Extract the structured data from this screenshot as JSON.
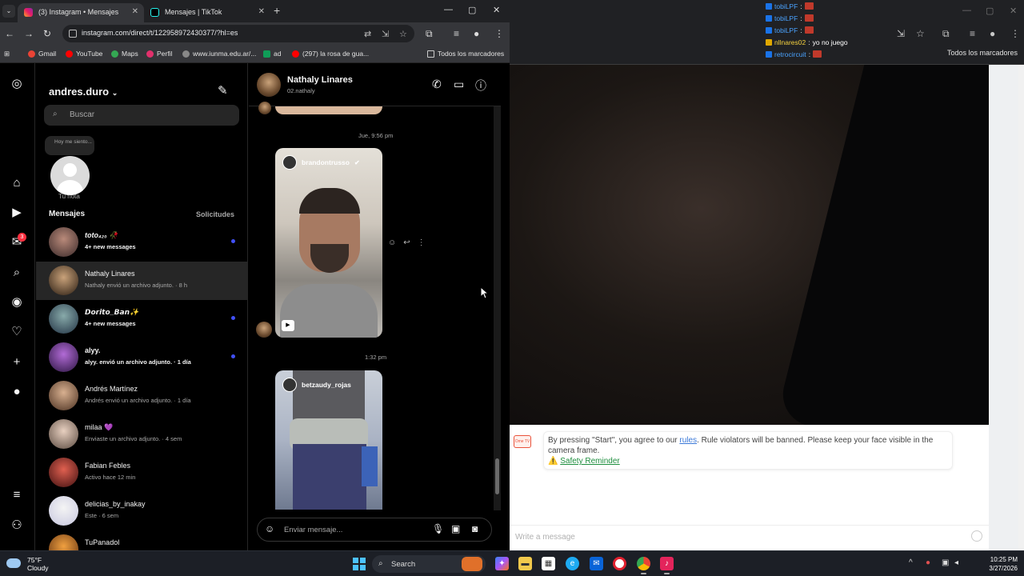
{
  "browser": {
    "tabs": [
      {
        "label": "(3) Instagram • Mensajes",
        "active": true
      },
      {
        "label": "Mensajes | TikTok",
        "active": false
      }
    ],
    "url": "instagram.com/direct/t/122958972430377/?hl=es",
    "bookmarks": [
      "Gmail",
      "YouTube",
      "Maps",
      "Perfil",
      "www.iunma.edu.ar/...",
      "ad",
      "(297) la rosa de gua...",
      "Todos los marcadores"
    ]
  },
  "instagram": {
    "account": "andres.duro",
    "search_placeholder": "Buscar",
    "note_bubble": "Hoy me siento...",
    "note_label": "Tu nota",
    "messages_title": "Mensajes",
    "requests_label": "Solicitudes",
    "notification_count": "3",
    "conversations": [
      {
        "name": "toto₄₂₀ 🥀",
        "sub": "4+ new messages",
        "unread": true
      },
      {
        "name": "Nathaly Linares",
        "sub": "Nathaly envió un archivo adjunto. · 8 h",
        "unread": false
      },
      {
        "name": "𝘿𝙤𝙧𝙞𝙩𝙤_𝘽𝙖𝙣✨",
        "sub": "4+ new messages",
        "unread": true
      },
      {
        "name": "alyy.",
        "sub": "alyy. envió un archivo adjunto. · 1 día",
        "unread": true
      },
      {
        "name": "Andrés Martínez",
        "sub": "Andrés envió un archivo adjunto. · 1 día",
        "unread": false
      },
      {
        "name": "milaa 💜",
        "sub": "Enviaste un archivo adjunto. · 4 sem",
        "unread": false
      },
      {
        "name": "Fabian Febles",
        "sub": "Activo hace 12 min",
        "unread": false
      },
      {
        "name": "delicias_by_inakay",
        "sub": "Este · 6 sem",
        "unread": false
      },
      {
        "name": "TuPanadol",
        "sub": "",
        "unread": false
      }
    ],
    "thread": {
      "name": "Nathaly Linares",
      "username": "02.nathaly",
      "timestamps": [
        "Jue, 9:56 pm",
        "1:32 pm"
      ],
      "reels": [
        "brandontrusso",
        "betzaudy_rojas"
      ],
      "composer_placeholder": "Enviar mensaje..."
    }
  },
  "right_window": {
    "chat": [
      {
        "user": "tobiLPF",
        "text": ""
      },
      {
        "user": "tobiLPF",
        "text": ""
      },
      {
        "user": "tobiLPF",
        "text": ""
      },
      {
        "user": "nllnares02",
        "text": "yo no juego"
      },
      {
        "user": "retrocircuit",
        "text": ""
      }
    ],
    "bookmarks_all": "Todos los marcadores",
    "notice_prefix": "By pressing \"Start\", you agree to our ",
    "notice_link": "rules",
    "notice_suffix": ". Rule violators will be banned. Please keep your face visible in the camera frame.",
    "safety": "Safety Reminder",
    "message_placeholder": "Write a message"
  },
  "taskbar": {
    "weather_temp": "75°F",
    "weather_desc": "Cloudy",
    "search": "Search",
    "time": "10:25 PM",
    "date": "3/27/2026"
  },
  "colors": {
    "ig_unread_dot": "#4150f7",
    "badge": "#ff3040",
    "win_accent": "#4cc2ff"
  }
}
